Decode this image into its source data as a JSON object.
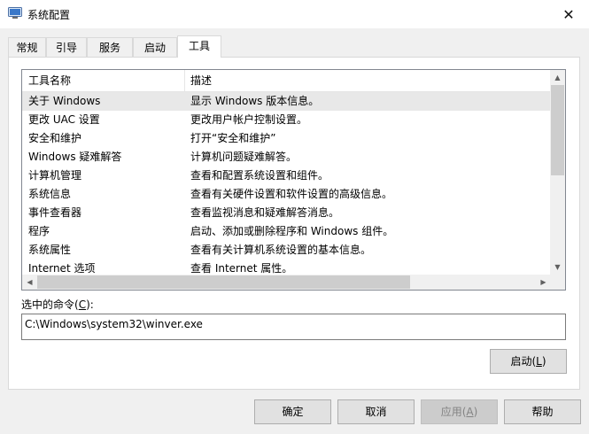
{
  "window": {
    "title": "系统配置",
    "close_glyph": "✕"
  },
  "tabs": [
    {
      "label": "常规"
    },
    {
      "label": "引导"
    },
    {
      "label": "服务"
    },
    {
      "label": "启动"
    },
    {
      "label": "工具",
      "active": true
    }
  ],
  "tools_list": {
    "columns": {
      "name": "工具名称",
      "desc": "描述"
    },
    "rows": [
      {
        "name": "关于 Windows",
        "desc": "显示 Windows 版本信息。",
        "selected": true
      },
      {
        "name": "更改 UAC 设置",
        "desc": "更改用户帐户控制设置。"
      },
      {
        "name": "安全和维护",
        "desc": "打开“安全和维护”"
      },
      {
        "name": "Windows 疑难解答",
        "desc": "计算机问题疑难解答。"
      },
      {
        "name": "计算机管理",
        "desc": "查看和配置系统设置和组件。"
      },
      {
        "name": "系统信息",
        "desc": "查看有关硬件设置和软件设置的高级信息。"
      },
      {
        "name": "事件查看器",
        "desc": "查看监视消息和疑难解答消息。"
      },
      {
        "name": "程序",
        "desc": "启动、添加或删除程序和 Windows 组件。"
      },
      {
        "name": "系统属性",
        "desc": "查看有关计算机系统设置的基本信息。"
      },
      {
        "name": "Internet 选项",
        "desc": "查看 Internet 属性。"
      }
    ]
  },
  "selected_command": {
    "label_prefix": "选中的命令(",
    "label_key": "C",
    "label_suffix": "):",
    "value": "C:\\Windows\\system32\\winver.exe"
  },
  "buttons": {
    "launch": {
      "prefix": "启动(",
      "key": "L",
      "suffix": ")"
    },
    "ok": "确定",
    "cancel": "取消",
    "apply": {
      "prefix": "应用(",
      "key": "A",
      "suffix": ")"
    },
    "help": "帮助"
  },
  "colors": {
    "selected_row": "#e8e8e8",
    "panel_bg": "#ffffff",
    "window_bg": "#f0f0f0"
  }
}
